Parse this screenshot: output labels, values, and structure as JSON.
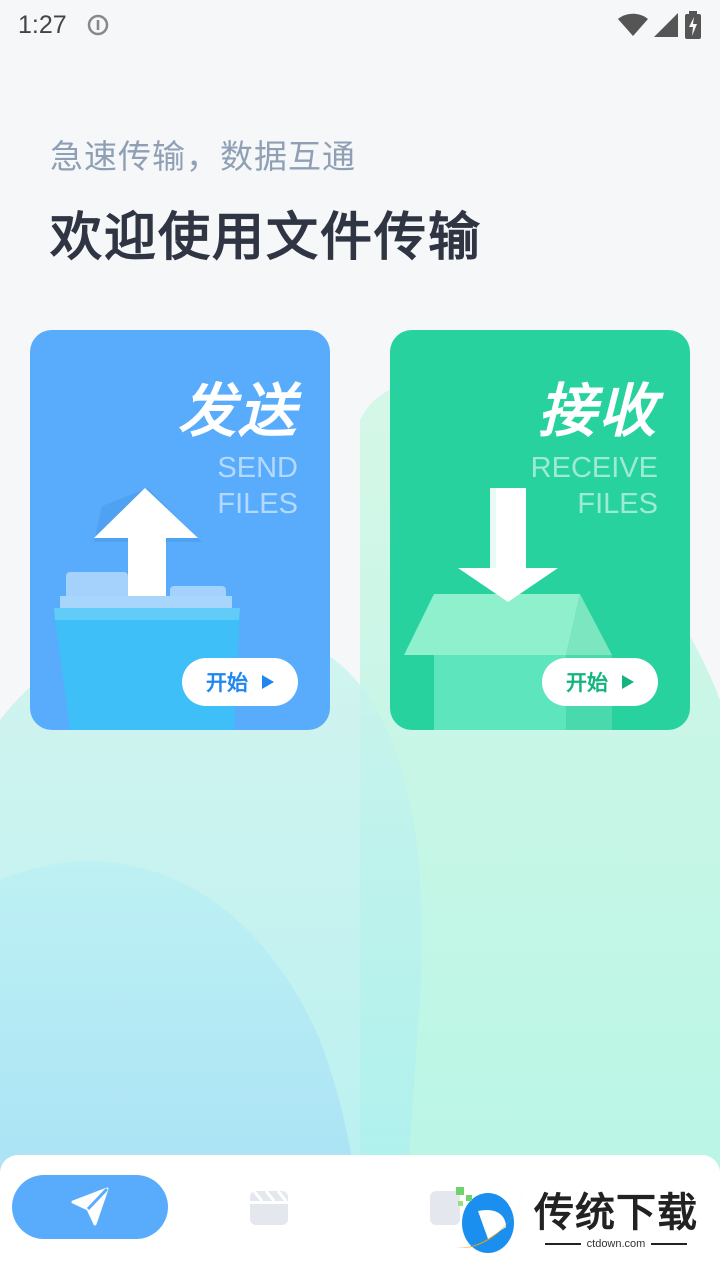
{
  "status_bar": {
    "time": "1:27"
  },
  "header": {
    "subtitle": "急速传输，数据互通",
    "title": "欢迎使用文件传输"
  },
  "cards": {
    "send": {
      "title_cn": "发送",
      "title_en_line1": "SEND",
      "title_en_line2": "FILES",
      "button_label": "开始",
      "color": "#59acfc"
    },
    "receive": {
      "title_cn": "接收",
      "title_en_line1": "RECEIVE",
      "title_en_line2": "FILES",
      "button_label": "开始",
      "color": "#28d29f"
    }
  },
  "bottom_nav": {
    "items": [
      {
        "icon": "send-arrow-icon",
        "active": true
      },
      {
        "icon": "media-icon",
        "active": false
      },
      {
        "icon": "folder-icon",
        "active": false
      }
    ],
    "active_color": "#59acfc"
  },
  "watermark": {
    "title": "传统下载",
    "url": "ctdown.com"
  }
}
